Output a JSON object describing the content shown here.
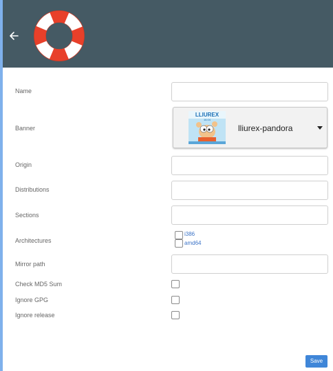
{
  "header": {
    "back_icon": "arrow-left-icon",
    "logo_icon": "lifebuoy-icon",
    "background": "#455a64"
  },
  "form": {
    "name_label": "Name",
    "name_value": "",
    "banner_label": "Banner",
    "banner_selected": "lliurex-pandora",
    "banner_image_text": "LLIUREX",
    "banner_image_subtext": "16.04",
    "origin_label": "Origin",
    "origin_value": "",
    "distributions_label": "Distributions",
    "distributions_value": "",
    "sections_label": "Sections",
    "sections_value": "",
    "architectures_label": "Architectures",
    "architectures": [
      {
        "label": "i386",
        "checked": false
      },
      {
        "label": "amd64",
        "checked": false
      }
    ],
    "mirror_path_label": "Mirror path",
    "mirror_path_value": "",
    "check_md5_label": "Check MD5 Sum",
    "check_md5_checked": false,
    "ignore_gpg_label": "Ignore GPG",
    "ignore_gpg_checked": false,
    "ignore_release_label": "Ignore release",
    "ignore_release_checked": false
  },
  "footer": {
    "save_label": "Save"
  },
  "colors": {
    "accent": "#3f86d8",
    "lifebuoy_red": "#e8402a",
    "desktop": "#7fb1ec"
  }
}
